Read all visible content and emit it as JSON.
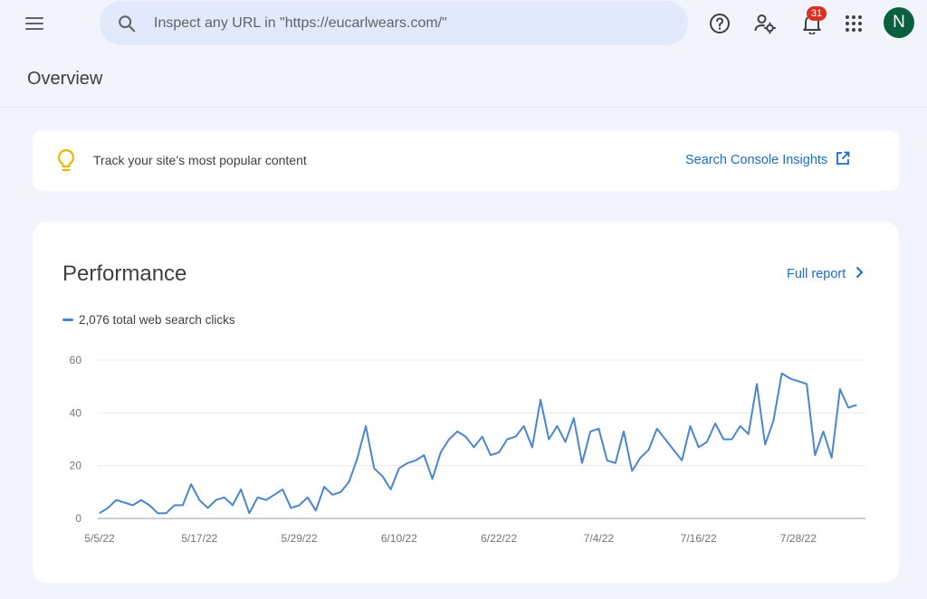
{
  "topbar": {
    "menu_icon": "hamburger-menu-icon",
    "search": {
      "placeholder": "Inspect any URL in \"https://eucarlwears.com/\"",
      "value": ""
    },
    "help_icon": "help-circle-icon",
    "account_settings_icon": "manage-accounts-icon",
    "notifications": {
      "icon": "bell-icon",
      "count": "31"
    },
    "apps_icon": "apps-grid-icon",
    "avatar": {
      "initial": "N",
      "color": "#0b5f3e"
    }
  },
  "page": {
    "title": "Overview"
  },
  "insight": {
    "icon": "lightbulb-icon",
    "text": "Track your site’s most popular content",
    "link_label": "Search Console Insights",
    "link_icon": "open-in-new-icon"
  },
  "performance": {
    "title": "Performance",
    "full_report_label": "Full report",
    "legend": "2,076 total web search clicks",
    "accent_color": "#4a86d0"
  },
  "chart_data": {
    "type": "line",
    "x_start": "5/5/22",
    "x_end": "8/5/22",
    "x_ticks": [
      "5/5/22",
      "5/17/22",
      "5/29/22",
      "6/10/22",
      "6/22/22",
      "7/4/22",
      "7/16/22",
      "7/28/22"
    ],
    "y_ticks": [
      0,
      20,
      40,
      60
    ],
    "ylim": [
      0,
      60
    ],
    "grid": true,
    "series": [
      {
        "values": [
          2,
          4,
          7,
          6,
          5,
          7,
          5,
          2,
          2,
          5,
          5,
          13,
          7,
          4,
          7,
          8,
          5,
          11,
          2,
          8,
          7,
          9,
          11,
          4,
          5,
          8,
          3,
          12,
          9,
          10,
          14,
          23,
          35,
          19,
          16,
          11,
          19,
          21,
          22,
          24,
          15,
          25,
          30,
          33,
          31,
          27,
          31,
          24,
          25,
          30,
          31,
          35,
          27,
          45,
          30,
          35,
          29,
          38,
          21,
          33,
          34,
          22,
          21,
          33,
          18,
          23,
          26,
          34,
          30,
          26,
          22,
          35,
          27,
          29,
          36,
          30,
          30,
          35,
          32,
          51,
          28,
          37,
          55,
          53,
          52,
          51,
          24,
          33,
          23,
          49,
          42,
          43
        ]
      }
    ]
  }
}
